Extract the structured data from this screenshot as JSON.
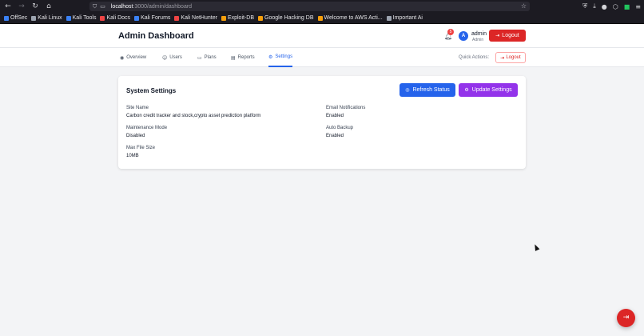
{
  "browser": {
    "url_host": "localhost",
    "url_path": ":3000/admin/dashboard",
    "bookmarks": [
      {
        "label": "OffSec",
        "color": "#3b82f6"
      },
      {
        "label": "Kali Linux",
        "color": "#9ca3af"
      },
      {
        "label": "Kali Tools",
        "color": "#3b82f6"
      },
      {
        "label": "Kali Docs",
        "color": "#ef4444"
      },
      {
        "label": "Kali Forums",
        "color": "#3b82f6"
      },
      {
        "label": "Kali NetHunter",
        "color": "#ef4444"
      },
      {
        "label": "Exploit-DB",
        "color": "#f59e0b"
      },
      {
        "label": "Google Hacking DB",
        "color": "#f59e0b"
      },
      {
        "label": "Welcome to AWS Acti...",
        "color": "#f59e0b"
      },
      {
        "label": "Important Ai",
        "color": "#9ca3af"
      }
    ]
  },
  "header": {
    "title": "Admin Dashboard",
    "notification_count": "5",
    "avatar_initial": "A",
    "user_name": "admin",
    "user_role": "Admin",
    "logout_label": "Logout"
  },
  "tabs": [
    {
      "label": "Overview",
      "icon": "eye-icon"
    },
    {
      "label": "Users",
      "icon": "users-icon"
    },
    {
      "label": "Plans",
      "icon": "card-icon"
    },
    {
      "label": "Reports",
      "icon": "document-icon"
    },
    {
      "label": "Settings",
      "icon": "gear-icon",
      "active": true
    }
  ],
  "quick_actions": {
    "label": "Quick Actions:",
    "logout_label": "Logout"
  },
  "settings_card": {
    "title": "System Settings",
    "refresh_label": "Refresh Status",
    "update_label": "Update Settings",
    "fields": {
      "site_name": {
        "label": "Site Name",
        "value": "Carbon credit tracker and stock,crypto asset prediction platform"
      },
      "email_notifications": {
        "label": "Email Notifications",
        "value": "Enabled"
      },
      "maintenance_mode": {
        "label": "Maintenance Mode",
        "value": "Disabled"
      },
      "auto_backup": {
        "label": "Auto Backup",
        "value": "Enabled"
      },
      "max_file_size": {
        "label": "Max File Size",
        "value": "10MB"
      }
    }
  },
  "colors": {
    "primary": "#2563eb",
    "danger": "#dc2626",
    "purple": "#9333ea"
  }
}
